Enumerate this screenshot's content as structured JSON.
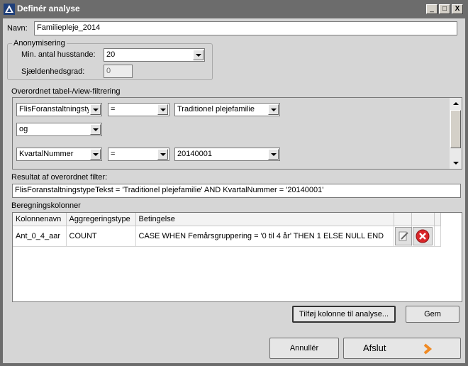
{
  "window": {
    "title": "Definér analyse",
    "icon": "app-logo-icon",
    "controls": {
      "minimize": "_",
      "maximize": "□",
      "close": "X"
    }
  },
  "name_field": {
    "label": "Navn:",
    "value": "Familiepleje_2014"
  },
  "anonymisering": {
    "caption": "Anonymisering",
    "min_households_label": "Min. antal husstande:",
    "min_households_value": "20",
    "rarity_label": "Sjældenhedsgrad:",
    "rarity_value": "0"
  },
  "filter_section": {
    "caption": "Overordnet tabel-/view-filtrering",
    "rows": [
      {
        "column": "FlisForanstaltningstyp",
        "operator": "=",
        "value": "Traditionel plejefamilie"
      },
      {
        "connector": "og"
      },
      {
        "column": "KvartalNummer",
        "operator": "=",
        "value": "20140001"
      }
    ]
  },
  "result_filter": {
    "label": "Resultat af overordnet filter:",
    "value": "FlisForanstaltningstypeTekst = 'Traditionel plejefamilie' AND KvartalNummer = '20140001'"
  },
  "columns_section": {
    "caption": "Beregningskolonner",
    "headers": [
      "Kolonnenavn",
      "Aggregeringstype",
      "Betingelse"
    ],
    "rows": [
      {
        "name": "Ant_0_4_aar",
        "aggregation": "COUNT",
        "condition": "CASE WHEN Femårsgruppering = '0 til 4 år' THEN 1 ELSE NULL END",
        "edit_icon": "edit-icon",
        "delete_icon": "delete-icon"
      }
    ]
  },
  "buttons": {
    "add_column": "Tilføj kolonne til analyse...",
    "save": "Gem",
    "cancel": "Annullér",
    "finish": "Afslut"
  },
  "colors": {
    "title_bar": "#6c6c6c",
    "background": "#d6d6d6",
    "delete_red": "#d9262a",
    "finish_arrow": "#f08a24"
  }
}
